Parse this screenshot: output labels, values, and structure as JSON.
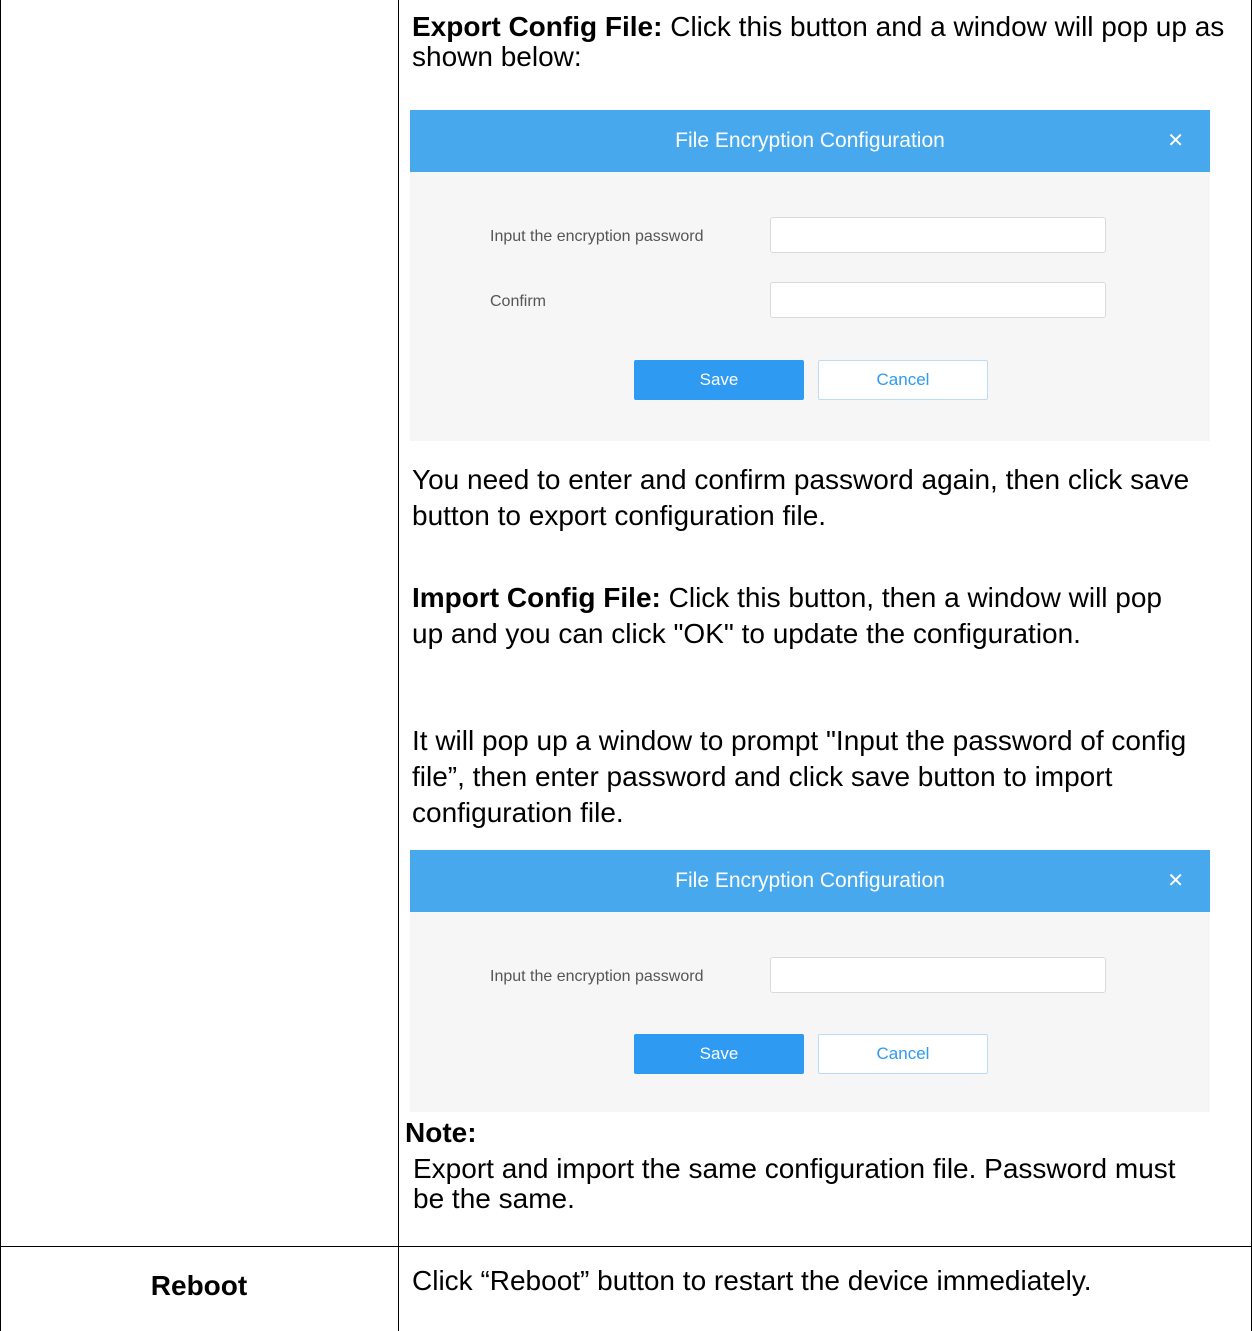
{
  "export_section": {
    "heading": "Export Config File:",
    "text": " Click this button and a window will pop up as shown below:",
    "after_text": "You need to enter and confirm password again, then click save button to export configuration file."
  },
  "export_dialog": {
    "title": "File Encryption Configuration",
    "close_icon": "close-icon",
    "password_label": "Input the encryption password",
    "confirm_label": "Confirm",
    "save_label": "Save",
    "cancel_label": "Cancel"
  },
  "import_section": {
    "heading": "Import Config File:",
    "text": " Click this button, then a window will pop up and you can click \"OK\" to update the configuration.",
    "prompt_text": "It will pop up a window to prompt \"Input the password of config file”, then enter password and click save button to import configuration file."
  },
  "import_dialog": {
    "title": "File Encryption Configuration",
    "close_icon": "close-icon",
    "password_label": "Input the encryption password",
    "save_label": "Save",
    "cancel_label": "Cancel"
  },
  "note": {
    "heading": "Note:",
    "text": "Export and import the same configuration file. Password must be the same."
  },
  "reboot_row": {
    "label": "Reboot",
    "description": "Click “Reboot” button to restart the device immediately."
  }
}
